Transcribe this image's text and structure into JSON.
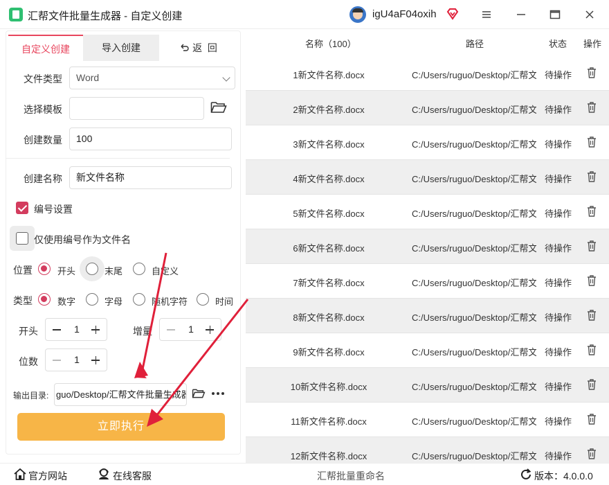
{
  "app": {
    "title": "汇帮文件批量生成器 - 自定义创建",
    "username": "igU4aF04oxih"
  },
  "tabs": {
    "custom": "自定义创建",
    "import": "导入创建",
    "back": "返  回"
  },
  "form": {
    "file_type_label": "文件类型",
    "file_type_value": "Word",
    "template_label": "选择模板",
    "template_value": "",
    "count_label": "创建数量",
    "count_value": "100",
    "name_label": "创建名称",
    "name_value": "新文件名称",
    "numbering_label": "编号设置",
    "numbering_checked": true,
    "only_number_label": "仅使用编号作为文件名",
    "only_number_checked": false,
    "position_label": "位置",
    "position_options": [
      "开头",
      "末尾",
      "自定义"
    ],
    "position_selected": "开头",
    "type_label": "类型",
    "type_options": [
      "数字",
      "字母",
      "随机字符",
      "时间"
    ],
    "type_selected": "数字",
    "start_label": "开头",
    "start_value": "1",
    "increment_label": "增量",
    "increment_value": "1",
    "digits_label": "位数",
    "digits_value": "1",
    "output_label": "输出目录:",
    "output_value": "guo/Desktop/汇帮文件批量生成器",
    "run_button": "立即执行"
  },
  "table": {
    "headers": {
      "name": "名称（100）",
      "path": "路径",
      "status": "状态",
      "op": "操作"
    },
    "rows": [
      {
        "name": "1新文件名称.docx",
        "path": "C:/Users/ruguo/Desktop/汇帮文",
        "status": "待操作"
      },
      {
        "name": "2新文件名称.docx",
        "path": "C:/Users/ruguo/Desktop/汇帮文",
        "status": "待操作"
      },
      {
        "name": "3新文件名称.docx",
        "path": "C:/Users/ruguo/Desktop/汇帮文",
        "status": "待操作"
      },
      {
        "name": "4新文件名称.docx",
        "path": "C:/Users/ruguo/Desktop/汇帮文",
        "status": "待操作"
      },
      {
        "name": "5新文件名称.docx",
        "path": "C:/Users/ruguo/Desktop/汇帮文",
        "status": "待操作"
      },
      {
        "name": "6新文件名称.docx",
        "path": "C:/Users/ruguo/Desktop/汇帮文",
        "status": "待操作"
      },
      {
        "name": "7新文件名称.docx",
        "path": "C:/Users/ruguo/Desktop/汇帮文",
        "status": "待操作"
      },
      {
        "name": "8新文件名称.docx",
        "path": "C:/Users/ruguo/Desktop/汇帮文",
        "status": "待操作"
      },
      {
        "name": "9新文件名称.docx",
        "path": "C:/Users/ruguo/Desktop/汇帮文",
        "status": "待操作"
      },
      {
        "name": "10新文件名称.docx",
        "path": "C:/Users/ruguo/Desktop/汇帮文",
        "status": "待操作"
      },
      {
        "name": "11新文件名称.docx",
        "path": "C:/Users/ruguo/Desktop/汇帮文",
        "status": "待操作"
      },
      {
        "name": "12新文件名称.docx",
        "path": "C:/Users/ruguo/Desktop/汇帮文",
        "status": "待操作"
      }
    ]
  },
  "footer": {
    "website": "官方网站",
    "support": "在线客服",
    "rename": "汇帮批量重命名",
    "version": "版本：4.0.0.0"
  },
  "colors": {
    "accent": "#e8465e",
    "run_button": "#f7b547",
    "annotation_arrow": "#e0203a"
  },
  "icons": [
    "app-icon",
    "avatar",
    "vip-diamond-icon",
    "menu-icon",
    "minimize-icon",
    "maximize-icon",
    "close-icon",
    "back-arrow-icon",
    "folder-icon",
    "more-icon",
    "trash-icon",
    "home-icon",
    "support-icon",
    "refresh-icon"
  ]
}
